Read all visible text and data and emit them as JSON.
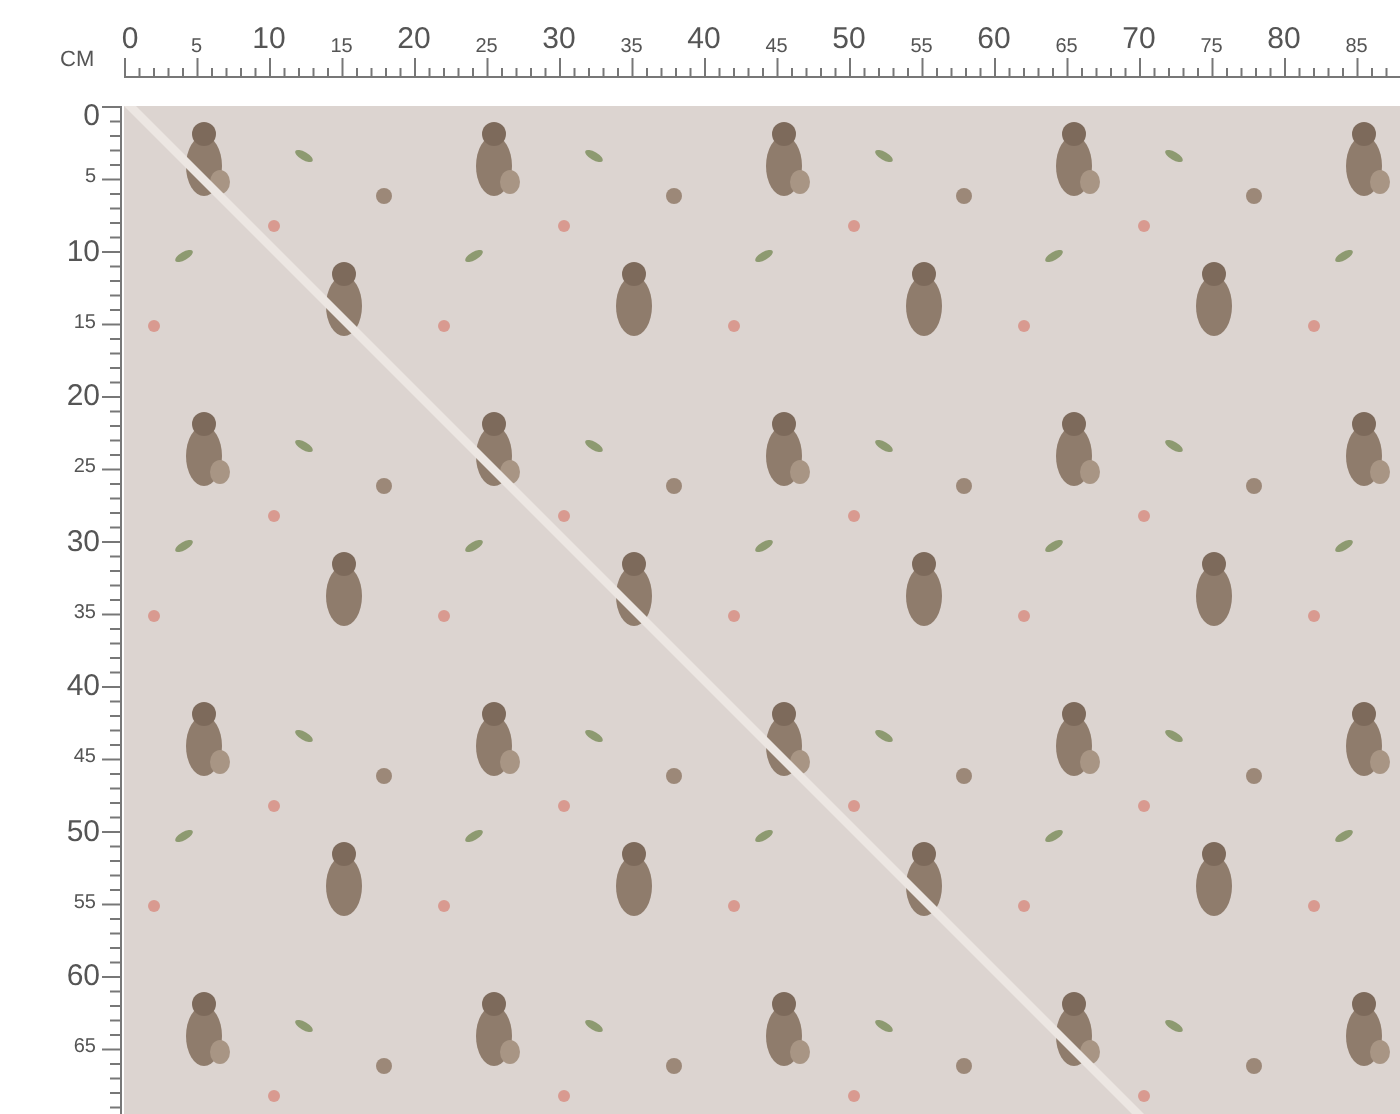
{
  "ruler_unit": "CM",
  "top_ruler": {
    "labels": [
      "0",
      "5",
      "10",
      "15",
      "20",
      "25",
      "30",
      "35",
      "40",
      "45",
      "50",
      "55",
      "60",
      "65",
      "70",
      "75",
      "80",
      "85"
    ]
  },
  "left_ruler": {
    "labels": [
      "0",
      "5",
      "10",
      "15",
      "20",
      "25",
      "30",
      "35",
      "40",
      "45",
      "50",
      "55",
      "60",
      "65"
    ]
  }
}
